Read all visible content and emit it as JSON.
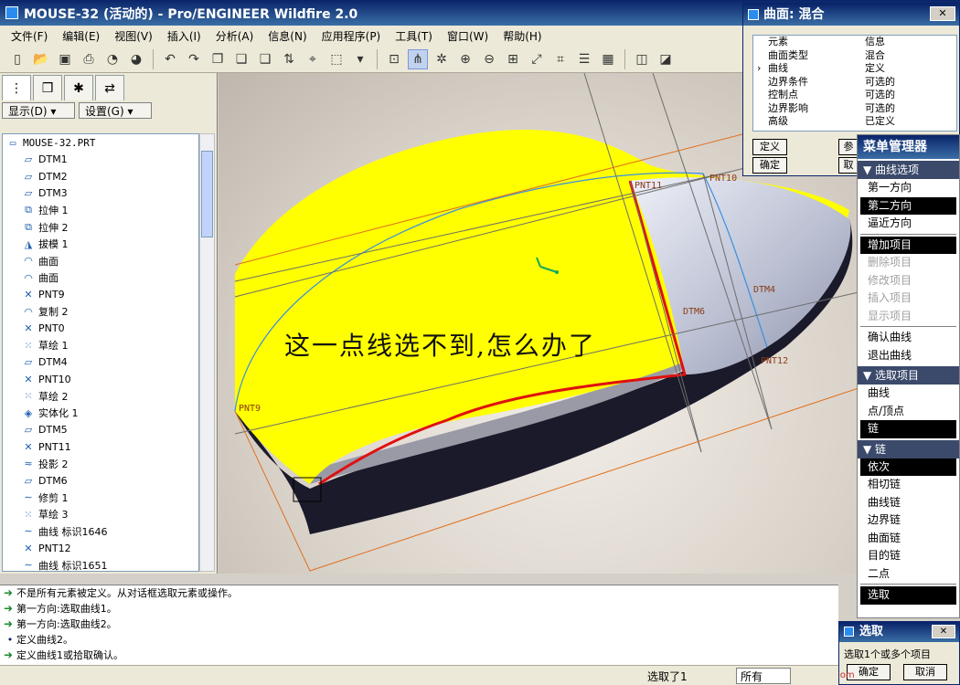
{
  "window": {
    "title": "MOUSE-32 (活动的) - Pro/ENGINEER Wildfire 2.0"
  },
  "menubar": [
    "文件(F)",
    "编辑(E)",
    "视图(V)",
    "插入(I)",
    "分析(A)",
    "信息(N)",
    "应用程序(P)",
    "工具(T)",
    "窗口(W)",
    "帮助(H)"
  ],
  "left_panel": {
    "buttons": {
      "show": "显示(D) ▾",
      "settings": "设置(G) ▾"
    },
    "tree": {
      "root": "MOUSE-32.PRT",
      "items": [
        {
          "icon": "datum-plane-icon",
          "glyph": "▱",
          "label": "DTM1"
        },
        {
          "icon": "datum-plane-icon",
          "glyph": "▱",
          "label": "DTM2"
        },
        {
          "icon": "datum-plane-icon",
          "glyph": "▱",
          "label": "DTM3"
        },
        {
          "icon": "extrude-icon",
          "glyph": "⧉",
          "label": "拉伸 1"
        },
        {
          "icon": "extrude-icon",
          "glyph": "⧉",
          "label": "拉伸 2"
        },
        {
          "icon": "draft-icon",
          "glyph": "◮",
          "label": "拔模 1"
        },
        {
          "icon": "surface-icon",
          "glyph": "◠",
          "label": "曲面"
        },
        {
          "icon": "surface-icon",
          "glyph": "◠",
          "label": "曲面"
        },
        {
          "icon": "datum-point-icon",
          "glyph": "✕",
          "label": "PNT9"
        },
        {
          "icon": "copy-icon",
          "glyph": "◠",
          "label": "复制 2"
        },
        {
          "icon": "datum-point-icon",
          "glyph": "✕",
          "label": "PNT0"
        },
        {
          "icon": "sketch-icon",
          "glyph": "⁙",
          "label": "草绘 1"
        },
        {
          "icon": "datum-plane-icon",
          "glyph": "▱",
          "label": "DTM4"
        },
        {
          "icon": "datum-point-icon",
          "glyph": "✕",
          "label": "PNT10"
        },
        {
          "icon": "sketch-icon",
          "glyph": "⁙",
          "label": "草绘 2"
        },
        {
          "icon": "solidify-icon",
          "glyph": "◈",
          "label": "实体化 1"
        },
        {
          "icon": "datum-plane-icon",
          "glyph": "▱",
          "label": "DTM5"
        },
        {
          "icon": "datum-point-icon",
          "glyph": "✕",
          "label": "PNT11"
        },
        {
          "icon": "project-icon",
          "glyph": "≈",
          "label": "投影 2"
        },
        {
          "icon": "datum-plane-icon",
          "glyph": "▱",
          "label": "DTM6"
        },
        {
          "icon": "trim-icon",
          "glyph": "∼",
          "label": "修剪 1"
        },
        {
          "icon": "sketch-icon",
          "glyph": "⁙",
          "label": "草绘 3"
        },
        {
          "icon": "curve-icon",
          "glyph": "∼",
          "label": "曲线 标识1646"
        },
        {
          "icon": "datum-point-icon",
          "glyph": "✕",
          "label": "PNT12"
        },
        {
          "icon": "curve-icon",
          "glyph": "∼",
          "label": "曲线 标识1651"
        }
      ]
    }
  },
  "viewport": {
    "annotation": "这一点线选不到,怎么办了",
    "points": {
      "pnt9": "PNT9",
      "pnt11": "PNT11",
      "pnt10": "PNT10",
      "pnt12": "PNT12",
      "dtm6": "DTM6",
      "dtm4": "DTM4"
    }
  },
  "blend_dialog": {
    "title": "曲面: 混合",
    "header": {
      "element": "元素",
      "info": "信息"
    },
    "rows": [
      {
        "element": "曲面类型",
        "info": "混合",
        "current": false
      },
      {
        "element": "曲线",
        "info": "定义",
        "current": true
      },
      {
        "element": "边界条件",
        "info": "可选的",
        "current": false
      },
      {
        "element": "控制点",
        "info": "可选的",
        "current": false
      },
      {
        "element": "边界影响",
        "info": "可选的",
        "current": false
      },
      {
        "element": "高级",
        "info": "已定义",
        "current": false
      }
    ],
    "buttons": {
      "define": "定义",
      "ok": "确定",
      "ref": "参",
      "cancel": "取"
    }
  },
  "menu_manager": {
    "title": "菜单管理器",
    "sections": [
      {
        "title": "曲线选项",
        "items": [
          {
            "label": "第一方向",
            "state": "normal"
          },
          {
            "label": "第二方向",
            "state": "selected"
          },
          {
            "label": "逼近方向",
            "state": "normal"
          },
          {
            "label": "---"
          },
          {
            "label": "增加项目",
            "state": "selected"
          },
          {
            "label": "删除项目",
            "state": "disabled"
          },
          {
            "label": "修改项目",
            "state": "disabled"
          },
          {
            "label": "插入项目",
            "state": "disabled"
          },
          {
            "label": "显示项目",
            "state": "disabled"
          },
          {
            "label": "---"
          },
          {
            "label": "确认曲线",
            "state": "normal"
          },
          {
            "label": "退出曲线",
            "state": "normal"
          }
        ]
      },
      {
        "title": "选取项目",
        "items": [
          {
            "label": "曲线",
            "state": "normal"
          },
          {
            "label": "点/顶点",
            "state": "normal"
          },
          {
            "label": "链",
            "state": "selected"
          }
        ]
      },
      {
        "title": "链",
        "items": [
          {
            "label": "依次",
            "state": "selected"
          },
          {
            "label": "相切链",
            "state": "normal"
          },
          {
            "label": "曲线链",
            "state": "normal"
          },
          {
            "label": "边界链",
            "state": "normal"
          },
          {
            "label": "曲面链",
            "state": "normal"
          },
          {
            "label": "目的链",
            "state": "normal"
          },
          {
            "label": "二点",
            "state": "normal"
          },
          {
            "label": "---"
          },
          {
            "label": "选取",
            "state": "selected"
          }
        ]
      }
    ]
  },
  "select_dialog": {
    "title": "选取",
    "message": "选取1个或多个项目",
    "ok": "确定",
    "cancel": "取消"
  },
  "messages": [
    {
      "type": "arrow",
      "text": "不是所有元素被定义。从对话框选取元素或操作。"
    },
    {
      "type": "arrow",
      "text": "第一方向:选取曲线1。"
    },
    {
      "type": "arrow",
      "text": "第一方向:选取曲线2。"
    },
    {
      "type": "dot",
      "text": "定义曲线2。"
    },
    {
      "type": "arrow",
      "text": "定义曲线1或拾取确认。"
    }
  ],
  "status": {
    "selected": "选取了1",
    "filter": "所有"
  },
  "watermark": {
    "site": "www.mfcad.com"
  },
  "colors": {
    "surface_yellow": "#ffff00",
    "selected_red": "#e01010",
    "title_blue": "#0a246a"
  }
}
